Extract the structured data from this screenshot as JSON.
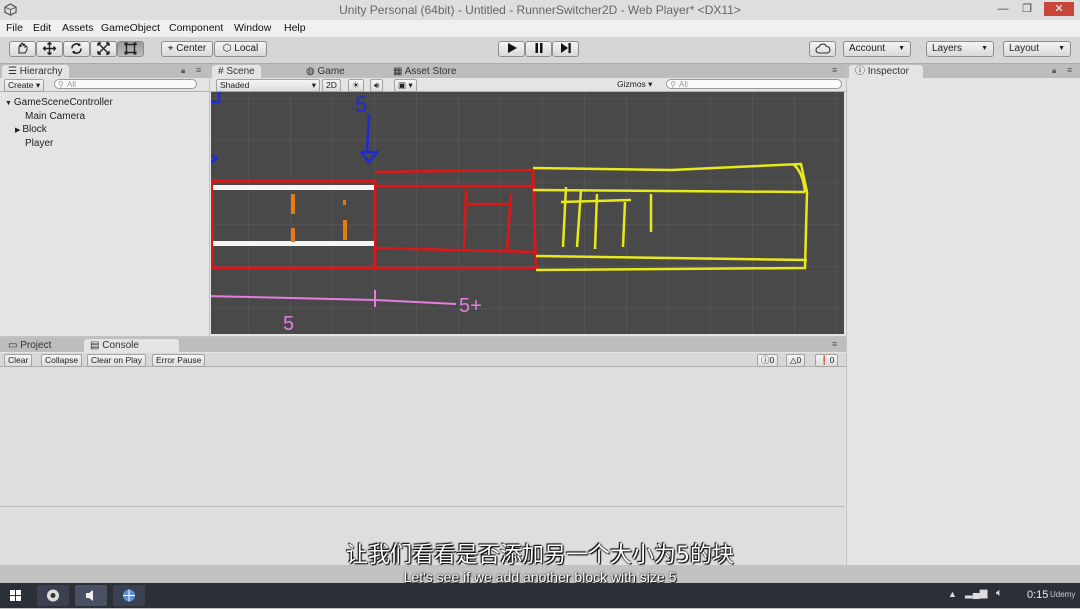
{
  "window": {
    "title": "Unity Personal (64bit) - Untitled - RunnerSwitcher2D - Web Player* <DX11>",
    "minimize": "—",
    "maximize": "❐",
    "close": "✕"
  },
  "menu": [
    "File",
    "Edit",
    "Assets",
    "GameObject",
    "Component",
    "Window",
    "Help"
  ],
  "toolbar": {
    "tools": [
      "hand-icon",
      "move-icon",
      "rotate-icon",
      "scale-icon",
      "rect-icon"
    ],
    "pivot": "Center",
    "space": "Local",
    "account": "Account",
    "layers": "Layers",
    "layout": "Layout"
  },
  "hierarchy": {
    "tab": "Hierarchy",
    "create": "Create",
    "search_placeholder": "All",
    "root": "GameSceneController",
    "items": [
      "Main Camera",
      "Block",
      "Player"
    ]
  },
  "scene": {
    "tabs": [
      "Scene",
      "Game",
      "Asset Store"
    ],
    "shading": "Shaded",
    "mode2d": "2D",
    "gizmos": "Gizmos",
    "search_placeholder": "All",
    "annotations": {
      "top_label": "5",
      "bottom_left": "5",
      "bottom_right": "5+"
    }
  },
  "inspector": {
    "tab": "Inspector"
  },
  "console": {
    "tabs": [
      "Project",
      "Console"
    ],
    "buttons": [
      "Clear",
      "Collapse",
      "Clear on Play",
      "Error Pause"
    ],
    "counts": [
      "0",
      "0",
      "0"
    ]
  },
  "subtitles": {
    "zh": "让我们看看是否添加另一个大小为5的块",
    "en": "Let's see if we add another block with size 5"
  },
  "taskbar": {
    "time": "0:15",
    "brand": "Udemy"
  }
}
